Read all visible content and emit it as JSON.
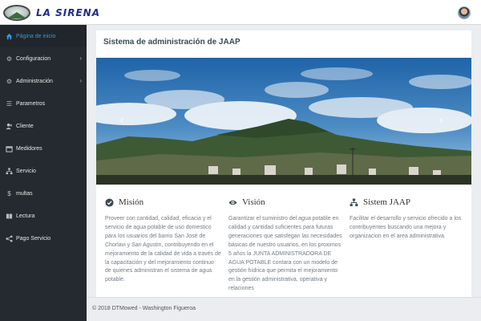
{
  "app": {
    "brand": "LA SIRENA"
  },
  "sidebar": {
    "items": [
      {
        "label": "Página de inicio",
        "icon": "home-icon",
        "active": true,
        "submenu": false
      },
      {
        "label": "Configuracion",
        "icon": "gear-icon",
        "active": false,
        "submenu": true
      },
      {
        "label": "Administración",
        "icon": "gear-icon",
        "active": false,
        "submenu": true
      },
      {
        "label": "Parametros",
        "icon": "list-icon",
        "active": false,
        "submenu": false
      },
      {
        "label": "Cliente",
        "icon": "user-plus-icon",
        "active": false,
        "submenu": false
      },
      {
        "label": "Medidores",
        "icon": "box-icon",
        "active": false,
        "submenu": false
      },
      {
        "label": "Servicio",
        "icon": "sitemap-icon",
        "active": false,
        "submenu": false
      },
      {
        "label": "multas",
        "icon": "dollar-icon",
        "active": false,
        "submenu": false
      },
      {
        "label": "Lectura",
        "icon": "book-icon",
        "active": false,
        "submenu": false
      },
      {
        "label": "Pago Servicio",
        "icon": "share-icon",
        "active": false,
        "submenu": false
      }
    ]
  },
  "main": {
    "title": "Sistema de administración de JAAP",
    "sections": [
      {
        "heading": "Misión",
        "icon": "check-circle-icon",
        "text": "Proveer con cantidad, calidad, eficacia y el servicio de agua potable de uso domestico para los usuarios del barrio San José de Chorlavi y San Agustin, contribuyendo en el mejoramiento de la calidad de vida a través de la capacitación y del mejoramiento continuo de quienes administran el sistema de agua potable."
      },
      {
        "heading": "Visión",
        "icon": "eye-icon",
        "text": "Garantizar el suministro del agua potable en calidad y cantidad suficientes para futuras generaciones que satisfegan las necesidades básicas de nuestro usuarios, en los proximos 5 años la JUNTA ADMINISTRADORA DE AGUA POTABLE contara con un modelo de gestión hídrica que permita el mejoramiento en la gestión administrativa, operativa y relaciones"
      },
      {
        "heading": "Sistem JAAP",
        "icon": "sitemap-icon",
        "text": "Facilitar el desarrollo y servicio ofrecido a los contribuyentes buscando una mejora y organizacion en el area administrativa."
      }
    ]
  },
  "footer": {
    "text": "© 2018 DTMowed - Washington Figueroa"
  },
  "colors": {
    "sidebar_bg": "#242a30",
    "active": "#3a98d8",
    "brand": "#1d2b8f"
  }
}
